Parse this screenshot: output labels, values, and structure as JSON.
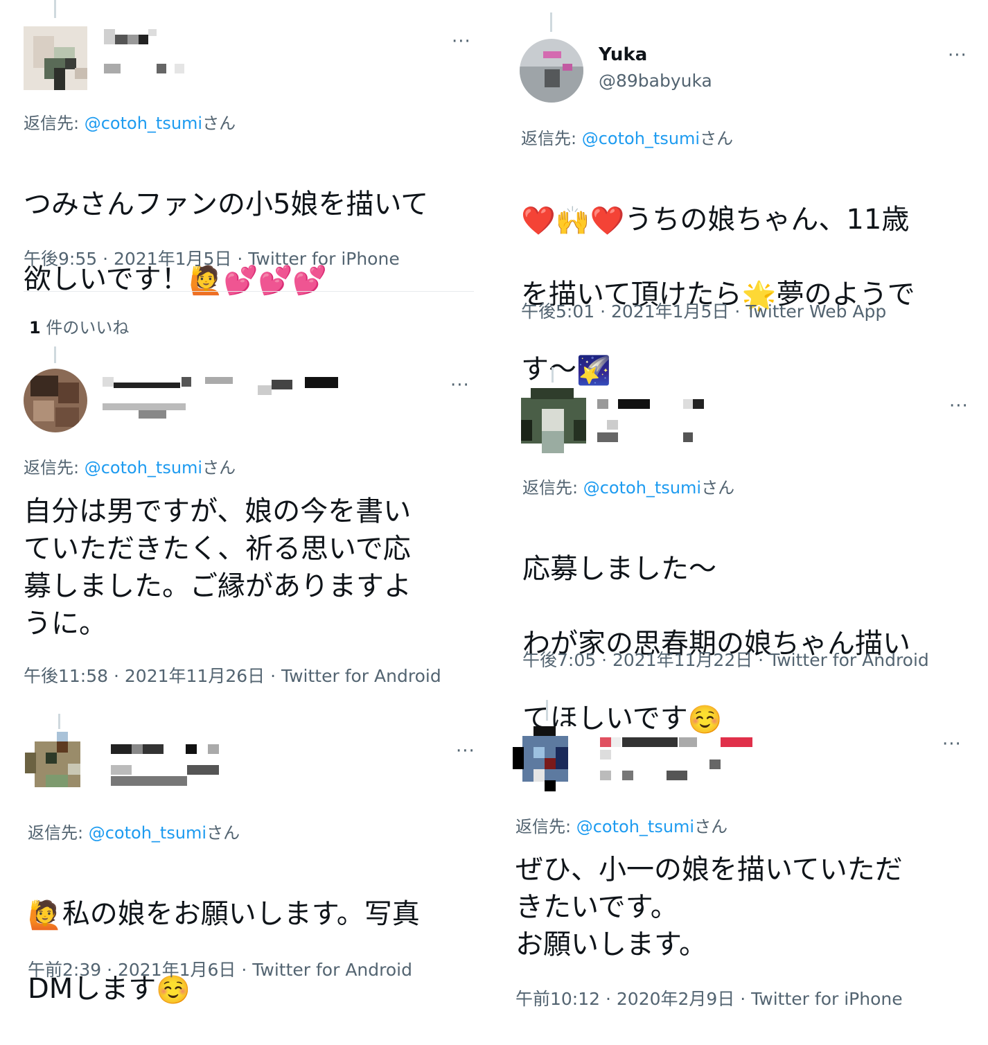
{
  "tweets": [
    {
      "reply_prefix": "返信先: ",
      "reply_handle": "@cotoh_tsumi",
      "reply_suffix": "さん",
      "text_line1": "つみさんファンの小5娘を描いて",
      "text_line2": "欲しいです！",
      "meta": "午後9:55 · 2021年1月5日 · Twitter for iPhone",
      "more": "···"
    },
    {
      "name": "Yuka",
      "handle": "@89babyuka",
      "reply_prefix": "返信先: ",
      "reply_handle": "@cotoh_tsumi",
      "reply_suffix": "さん",
      "text_line1": "うちの娘ちゃん、11歳",
      "text_line2a": "を描いて頂けたら",
      "text_line2b": "夢のようで",
      "text_line3": "す〜",
      "meta": "午後5:01 · 2021年1月5日 · Twitter Web App",
      "more": "···"
    },
    {
      "reply_prefix": "返信先: ",
      "reply_handle": "@cotoh_tsumi",
      "reply_suffix": "さん",
      "text": "自分は男ですが、娘の今を書い\nていただきたく、祈る思いで応\n募しました。ご縁がありますよ\nうに。",
      "meta": "午後11:58 · 2021年11月26日 · Twitter for Android",
      "more": "···"
    },
    {
      "reply_prefix": "返信先: ",
      "reply_handle": "@cotoh_tsumi",
      "reply_suffix": "さん",
      "text_line1": "応募しました〜",
      "text_line2": "わが家の思春期の娘ちゃん描い",
      "text_line3": "てほしいです",
      "meta": "午後7:05 · 2021年11月22日 · Twitter for Android",
      "more": "···"
    },
    {
      "reply_prefix": "返信先: ",
      "reply_handle": "@cotoh_tsumi",
      "reply_suffix": "さん",
      "text_line1": "私の娘をお願いします。写真",
      "text_line2": "DMします",
      "meta": "午前2:39 · 2021年1月6日 · Twitter for Android",
      "more": "···"
    },
    {
      "reply_prefix": "返信先: ",
      "reply_handle": "@cotoh_tsumi",
      "reply_suffix": "さん",
      "text": "ぜひ、小一の娘を描いていただ\nきたいです。\nお願いします。",
      "meta": "午前10:12 · 2020年2月9日 · Twitter for iPhone",
      "more": "···"
    }
  ],
  "likes": {
    "count": "1",
    "label": " 件のいいね"
  },
  "emoji": {
    "raising_hand": "🙋",
    "two_hearts": "💕",
    "red_heart": "❤️",
    "raised_hands": "🙌",
    "glowing_star": "🌟",
    "shooting_star": "🌠",
    "smiling_face": "☺️"
  }
}
